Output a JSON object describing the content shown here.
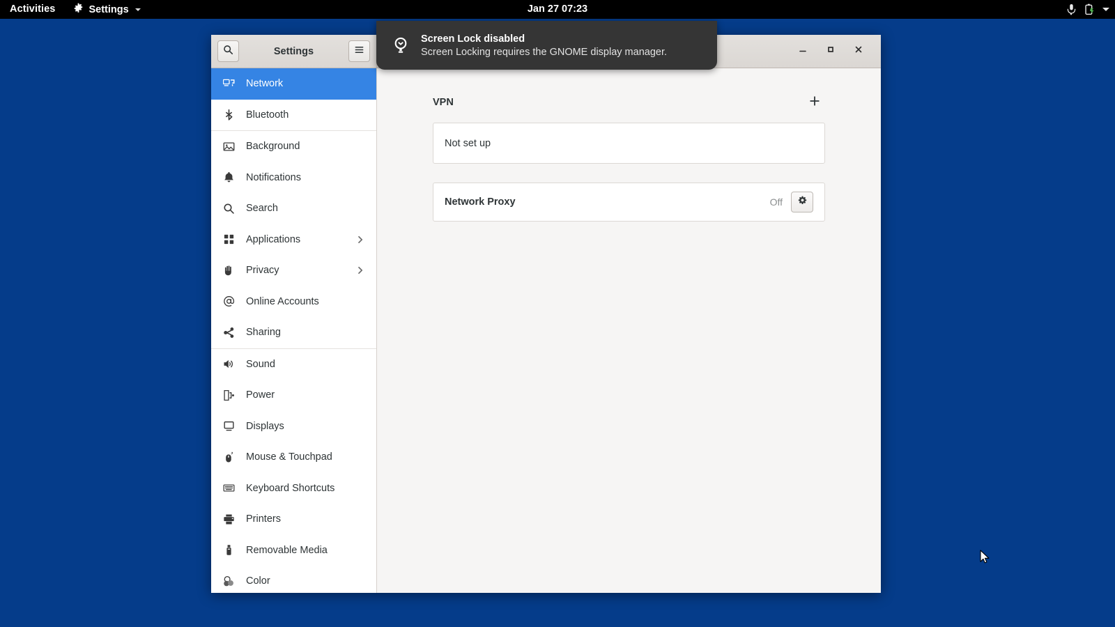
{
  "topbar": {
    "activities": "Activities",
    "app_menu": "Settings",
    "clock": "Jan 27  07:23",
    "icons": [
      "microphone-icon",
      "battery-charging-icon",
      "system-menu-chevron-icon"
    ],
    "background_color": "#000000"
  },
  "desktop": {
    "background_color": "#053c8a"
  },
  "notification": {
    "icon": "lightbulb-hint-icon",
    "title": "Screen Lock disabled",
    "body": "Screen Locking requires the GNOME display manager.",
    "background_color": "#353535"
  },
  "window": {
    "title": "Settings",
    "search_button": "search-icon",
    "menu_button": "hamburger-menu-icon",
    "controls": {
      "minimize": "minimize-icon",
      "maximize": "maximize-icon",
      "close": "close-icon"
    }
  },
  "sidebar": {
    "accent_color": "#3584e4",
    "items": [
      {
        "label": "Network",
        "icon": "network-icon",
        "active": true,
        "chevron": false,
        "separator_after": false
      },
      {
        "label": "Bluetooth",
        "icon": "bluetooth-icon",
        "active": false,
        "chevron": false,
        "separator_after": true
      },
      {
        "label": "Background",
        "icon": "background-icon",
        "active": false,
        "chevron": false,
        "separator_after": false
      },
      {
        "label": "Notifications",
        "icon": "bell-icon",
        "active": false,
        "chevron": false,
        "separator_after": false
      },
      {
        "label": "Search",
        "icon": "search-icon",
        "active": false,
        "chevron": false,
        "separator_after": false
      },
      {
        "label": "Applications",
        "icon": "apps-grid-icon",
        "active": false,
        "chevron": true,
        "separator_after": false
      },
      {
        "label": "Privacy",
        "icon": "hand-icon",
        "active": false,
        "chevron": true,
        "separator_after": false
      },
      {
        "label": "Online Accounts",
        "icon": "at-sign-icon",
        "active": false,
        "chevron": false,
        "separator_after": false
      },
      {
        "label": "Sharing",
        "icon": "share-icon",
        "active": false,
        "chevron": false,
        "separator_after": true
      },
      {
        "label": "Sound",
        "icon": "speaker-icon",
        "active": false,
        "chevron": false,
        "separator_after": false
      },
      {
        "label": "Power",
        "icon": "power-plug-icon",
        "active": false,
        "chevron": false,
        "separator_after": false
      },
      {
        "label": "Displays",
        "icon": "monitor-icon",
        "active": false,
        "chevron": false,
        "separator_after": false
      },
      {
        "label": "Mouse & Touchpad",
        "icon": "mouse-icon",
        "active": false,
        "chevron": false,
        "separator_after": false
      },
      {
        "label": "Keyboard Shortcuts",
        "icon": "keyboard-icon",
        "active": false,
        "chevron": false,
        "separator_after": false
      },
      {
        "label": "Printers",
        "icon": "printer-icon",
        "active": false,
        "chevron": false,
        "separator_after": false
      },
      {
        "label": "Removable Media",
        "icon": "usb-drive-icon",
        "active": false,
        "chevron": false,
        "separator_after": false
      },
      {
        "label": "Color",
        "icon": "color-icon",
        "active": false,
        "chevron": false,
        "separator_after": false
      }
    ]
  },
  "content": {
    "vpn": {
      "section_title": "VPN",
      "add_button": "plus-icon",
      "status": "Not set up"
    },
    "proxy": {
      "label": "Network Proxy",
      "status": "Off",
      "settings_button": "gear-icon"
    }
  }
}
